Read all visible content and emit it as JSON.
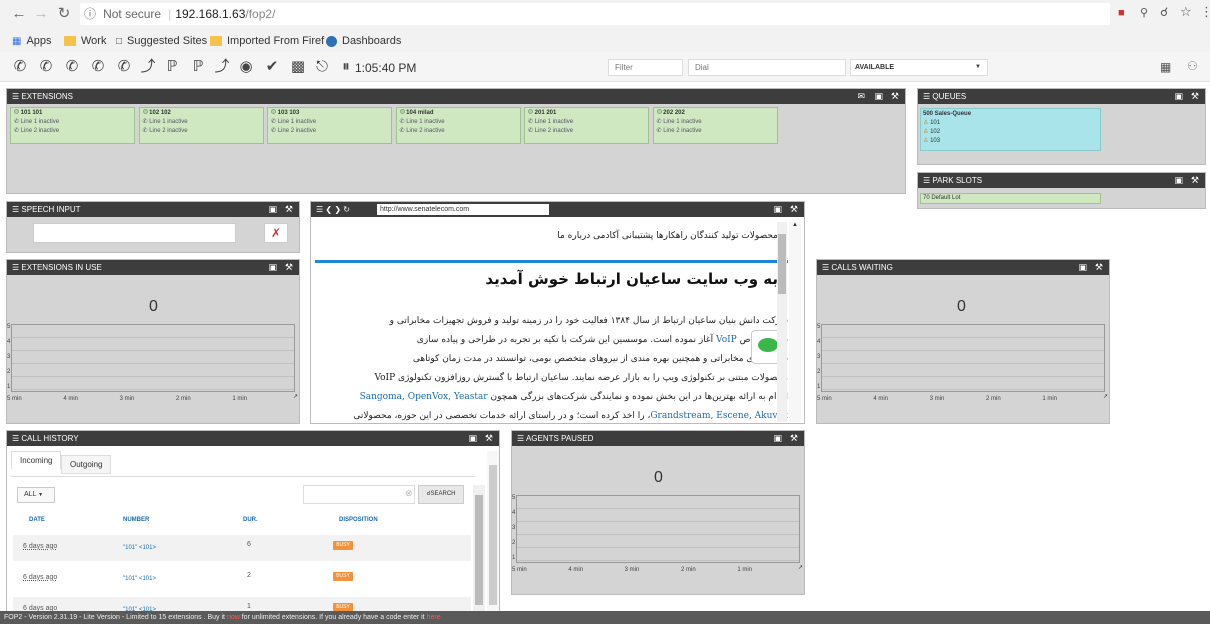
{
  "browser": {
    "security": "Not secure",
    "url_host": "192.168.1.63",
    "url_path": "/fop2/",
    "bookmarks": [
      "Apps",
      "Work",
      "Suggested Sites",
      "Imported From Firef",
      "Dashboards"
    ]
  },
  "toolbar": {
    "clock": "1:05:40 PM",
    "filter_placeholder": "Filter",
    "dial_placeholder": "Dial",
    "status": "AVAILABLE"
  },
  "extensions_panel": {
    "title": "EXTENSIONS",
    "items": [
      {
        "name": "101 101",
        "line1": "Line 1 inactive",
        "line2": "Line 2 inactive"
      },
      {
        "name": "102 102",
        "line1": "Line 1 inactive",
        "line2": "Line 2 inactive"
      },
      {
        "name": "103 103",
        "line1": "Line 1 inactive",
        "line2": "Line 2 inactive"
      },
      {
        "name": "104 milad",
        "line1": "Line 1 inactive",
        "line2": "Line 2 inactive"
      },
      {
        "name": "201 201",
        "line1": "Line 1 inactive",
        "line2": "Line 2 inactive"
      },
      {
        "name": "202 202",
        "line1": "Line 1 inactive",
        "line2": "Line 2 inactive"
      }
    ]
  },
  "queues_panel": {
    "title": "QUEUES",
    "queue_name": "500 Sales-Queue",
    "members": [
      "101",
      "102",
      "103"
    ]
  },
  "park_panel": {
    "title": "PARK SLOTS",
    "lot": "70 Default Lot"
  },
  "speech_panel": {
    "title": "SPEECH INPUT"
  },
  "ext_in_use": {
    "title": "EXTENSIONS IN USE",
    "value": "0",
    "y_ticks": [
      "5",
      "4",
      "3",
      "2",
      "1"
    ],
    "x_ticks": [
      "5 min",
      "4 min",
      "3 min",
      "2 min",
      "1 min"
    ]
  },
  "calls_waiting": {
    "title": "CALLS WAITING",
    "value": "0",
    "y_ticks": [
      "5",
      "4",
      "3",
      "2",
      "1"
    ],
    "x_ticks": [
      "5 min",
      "4 min",
      "3 min",
      "2 min",
      "1 min"
    ]
  },
  "agents_paused": {
    "title": "AGENTS PAUSED",
    "value": "0",
    "y_ticks": [
      "5",
      "4",
      "3",
      "2",
      "1"
    ],
    "x_ticks": [
      "5 min",
      "4 min",
      "3 min",
      "2 min",
      "1 min"
    ]
  },
  "web_panel": {
    "url": "http://www.senatelecom.com",
    "menu": "محصولات   تولید کنندگان   راهکارها   پشتیبانی   آکادمی   درباره ما",
    "heading": "به وب سایت ساعیان ارتباط خوش آمدید",
    "p1": "شرکت دانش بنیان ساعیان ارتباط از سال ۱۳۸۴ فعالیت خود را در زمینه تولید و فروش تجهیزات مخابراتی و",
    "p2a": "به طور خاص",
    "p2link": "VoIP",
    "p2b": "آغاز نموده است. موسسین این شرکت با تکیه بر تجربه در طراحی و پیاده سازی",
    "p3": "سیستم‌های مخابراتی و همچنین بهره مندی از نیروهای متخصص بومی، توانستند در مدت زمان کوتاهی",
    "p4": "محصولات مبتنی بر تکنولوژی ویپ را به بازار عرضه نمایند. ساعیان ارتباط با گسترش روزافزون تکنولوژی VoIP",
    "p5a": "اقدام به ارائه بهترین‌ها در این بخش نموده و نمایندگی شرکت‌های بزرگی همچون",
    "p5link": "Sangoma, OpenVox, Yeastar",
    "p6link": "Grandstream, Escene, Akuvox",
    "p6b": "را اخذ کرده است؛ و در راستای ارائه خدمات تخصصی در این حوزه، محصولاتی"
  },
  "call_history": {
    "title": "CALL HISTORY",
    "tabs": [
      "Incoming",
      "Outgoing"
    ],
    "filter": "ALL",
    "search_label": "SEARCH",
    "columns": [
      "DATE",
      "NUMBER",
      "DUR.",
      "DISPOSITION"
    ],
    "rows": [
      {
        "date": "6 days ago",
        "number": "\"101\" <101>",
        "dur": "6",
        "disp": "BUSY"
      },
      {
        "date": "6 days ago",
        "number": "\"101\" <101>",
        "dur": "2",
        "disp": "BUSY"
      },
      {
        "date": "6 days ago",
        "number": "\"101\" <101>",
        "dur": "1",
        "disp": "BUSY"
      }
    ]
  },
  "footer": {
    "text_a": "FOP2 - Version 2.31.19 - Lite Version - Limited to 15 extensions . Buy it ",
    "now": "now",
    "text_b": " for unlimited extensions. If you already have a code enter it ",
    "here": "here"
  }
}
